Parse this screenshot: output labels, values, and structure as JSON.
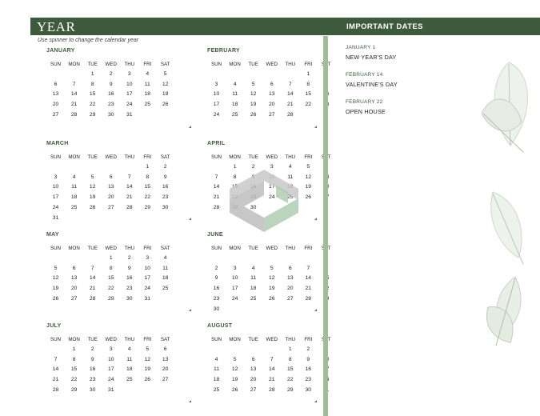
{
  "header": {
    "year_title": "YEAR",
    "important_dates_title": "IMPORTANT DATES"
  },
  "spinner_note": "Use spinner to change the calendar year",
  "weekdays": [
    "SUN",
    "MON",
    "TUE",
    "WED",
    "THU",
    "FRI",
    "SAT"
  ],
  "months": [
    {
      "name": "JANUARY",
      "rows": [
        [
          "",
          "",
          "1",
          "2",
          "3",
          "4",
          "5"
        ],
        [
          "6",
          "7",
          "8",
          "9",
          "10",
          "11",
          "12"
        ],
        [
          "13",
          "14",
          "15",
          "16",
          "17",
          "18",
          "19"
        ],
        [
          "20",
          "21",
          "22",
          "23",
          "24",
          "25",
          "26"
        ],
        [
          "27",
          "28",
          "29",
          "30",
          "31",
          "",
          ""
        ],
        [
          "",
          "",
          "",
          "",
          "",
          "",
          ""
        ]
      ]
    },
    {
      "name": "FEBRUARY",
      "rows": [
        [
          "",
          "",
          "",
          "",
          "",
          "1",
          "2"
        ],
        [
          "3",
          "4",
          "5",
          "6",
          "7",
          "8",
          "9"
        ],
        [
          "10",
          "11",
          "12",
          "13",
          "14",
          "15",
          "16"
        ],
        [
          "17",
          "18",
          "19",
          "20",
          "21",
          "22",
          "23"
        ],
        [
          "24",
          "25",
          "26",
          "27",
          "28",
          "",
          ""
        ],
        [
          "",
          "",
          "",
          "",
          "",
          "",
          ""
        ]
      ]
    },
    {
      "name": "MARCH",
      "rows": [
        [
          "",
          "",
          "",
          "",
          "",
          "1",
          "2"
        ],
        [
          "3",
          "4",
          "5",
          "6",
          "7",
          "8",
          "9"
        ],
        [
          "10",
          "11",
          "12",
          "13",
          "14",
          "15",
          "16"
        ],
        [
          "17",
          "18",
          "19",
          "20",
          "21",
          "22",
          "23"
        ],
        [
          "24",
          "25",
          "26",
          "27",
          "28",
          "29",
          "30"
        ],
        [
          "31",
          "",
          "",
          "",
          "",
          "",
          ""
        ]
      ]
    },
    {
      "name": "APRIL",
      "rows": [
        [
          "",
          "1",
          "2",
          "3",
          "4",
          "5",
          "6"
        ],
        [
          "7",
          "8",
          "9",
          "10",
          "11",
          "12",
          "13"
        ],
        [
          "14",
          "15",
          "16",
          "17",
          "18",
          "19",
          "20"
        ],
        [
          "21",
          "22",
          "23",
          "24",
          "25",
          "26",
          "27"
        ],
        [
          "28",
          "29",
          "30",
          "",
          "",
          "",
          ""
        ],
        [
          "",
          "",
          "",
          "",
          "",
          "",
          ""
        ]
      ]
    },
    {
      "name": "MAY",
      "rows": [
        [
          "",
          "",
          "",
          "1",
          "2",
          "3",
          "4"
        ],
        [
          "5",
          "6",
          "7",
          "8",
          "9",
          "10",
          "11"
        ],
        [
          "12",
          "13",
          "14",
          "15",
          "16",
          "17",
          "18"
        ],
        [
          "19",
          "20",
          "21",
          "22",
          "23",
          "24",
          "25"
        ],
        [
          "26",
          "27",
          "28",
          "29",
          "30",
          "31",
          ""
        ],
        [
          "",
          "",
          "",
          "",
          "",
          "",
          ""
        ]
      ]
    },
    {
      "name": "JUNE",
      "rows": [
        [
          "",
          "",
          "",
          "",
          "",
          "",
          "1"
        ],
        [
          "2",
          "3",
          "4",
          "5",
          "6",
          "7",
          "8"
        ],
        [
          "9",
          "10",
          "11",
          "12",
          "13",
          "14",
          "15"
        ],
        [
          "16",
          "17",
          "18",
          "19",
          "20",
          "21",
          "22"
        ],
        [
          "23",
          "24",
          "25",
          "26",
          "27",
          "28",
          "29"
        ],
        [
          "30",
          "",
          "",
          "",
          "",
          "",
          ""
        ]
      ]
    },
    {
      "name": "JULY",
      "rows": [
        [
          "",
          "1",
          "2",
          "3",
          "4",
          "5",
          "6"
        ],
        [
          "7",
          "8",
          "9",
          "10",
          "11",
          "12",
          "13"
        ],
        [
          "14",
          "15",
          "16",
          "17",
          "18",
          "19",
          "20"
        ],
        [
          "21",
          "22",
          "23",
          "24",
          "25",
          "26",
          "27"
        ],
        [
          "28",
          "29",
          "30",
          "31",
          "",
          "",
          ""
        ],
        [
          "",
          "",
          "",
          "",
          "",
          "",
          ""
        ]
      ]
    },
    {
      "name": "AUGUST",
      "rows": [
        [
          "",
          "",
          "",
          "",
          "1",
          "2",
          "3"
        ],
        [
          "4",
          "5",
          "6",
          "7",
          "8",
          "9",
          "10"
        ],
        [
          "11",
          "12",
          "13",
          "14",
          "15",
          "16",
          "17"
        ],
        [
          "18",
          "19",
          "20",
          "21",
          "22",
          "23",
          "24"
        ],
        [
          "25",
          "26",
          "27",
          "28",
          "29",
          "30",
          "31"
        ],
        [
          "",
          "",
          "",
          "",
          "",
          "",
          ""
        ]
      ]
    }
  ],
  "important_dates": [
    {
      "date": "JANUARY 1",
      "event": "NEW YEAR'S DAY"
    },
    {
      "date": "FEBRUARY 14",
      "event": "VALENTINE'S DAY"
    },
    {
      "date": "FEBRUARY 22",
      "event": "OPEN HOUSE"
    }
  ],
  "colors": {
    "header_bg": "#3e5a3c",
    "divider": "#9fbe98",
    "accent_text": "#3e5a3c"
  }
}
